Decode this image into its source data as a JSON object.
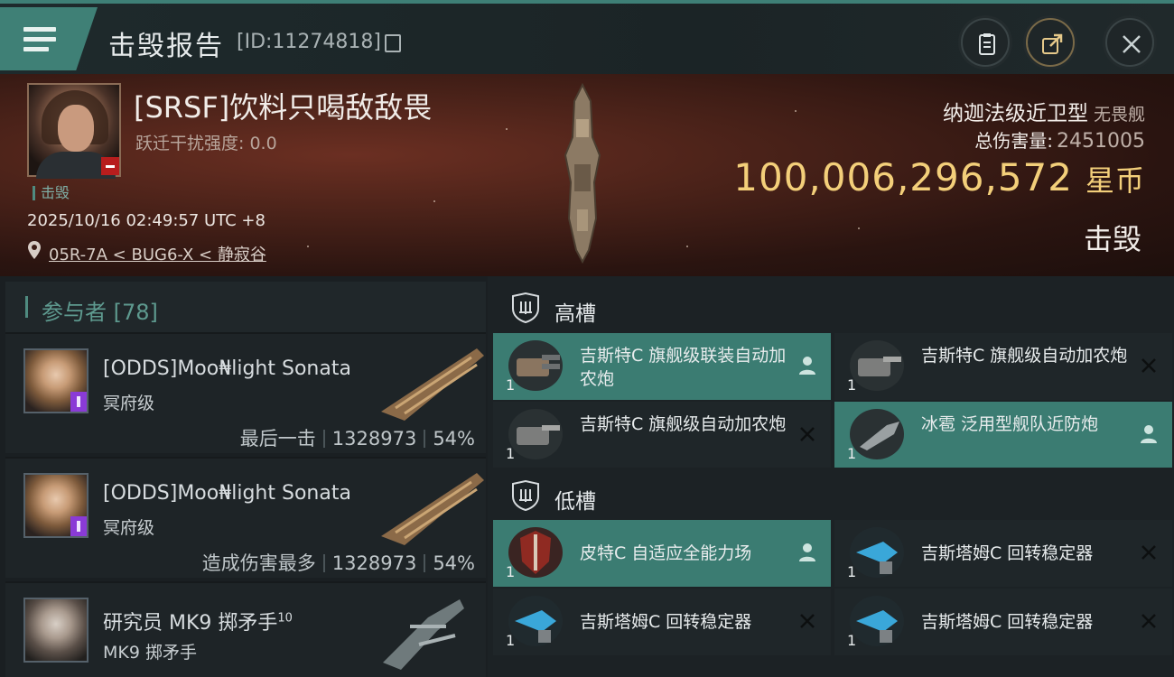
{
  "header": {
    "title": "击毁报告",
    "report_id": "[ID:11274818]"
  },
  "victim": {
    "name": "[SRSF]饮料只喝敌敌畏",
    "warp_disruption": "跃迁干扰强度: 0.0",
    "tag": "击毁",
    "time": "2025/10/16 02:49:57 UTC +8",
    "location": "05R-7A < BUG6-X < 静寂谷",
    "ship_class": "纳迦法级近卫型",
    "ship_class_sub": "无畏舰",
    "damage_label": "总伤害量:",
    "damage_value": "2451005",
    "isk_value": "100,006,296,572",
    "isk_unit": "星币",
    "status": "击毁"
  },
  "participants": {
    "label": "参与者 [78]",
    "rows": [
      {
        "name": "[ODDS]Moo₦light Sonata",
        "ship": "冥府级",
        "role": "最后一击",
        "damage": "1328973",
        "percent": "54%"
      },
      {
        "name": "[ODDS]Moo₦light Sonata",
        "ship": "冥府级",
        "role": "造成伤害最多",
        "damage": "1328973",
        "percent": "54%"
      },
      {
        "name": "研究员 MK9 掷矛手",
        "name_sup": "10",
        "ship": "MK9 掷矛手"
      }
    ]
  },
  "slots": {
    "high": {
      "label": "高槽",
      "modules": [
        {
          "name": "吉斯特C 旗舰级联装自动加农炮",
          "qty": "1",
          "state": "dropped"
        },
        {
          "name": "吉斯特C 旗舰级自动加农炮",
          "qty": "1",
          "state": "destroyed"
        },
        {
          "name": "吉斯特C 旗舰级自动加农炮",
          "qty": "1",
          "state": "destroyed"
        },
        {
          "name": "冰雹 泛用型舰队近防炮",
          "qty": "1",
          "state": "dropped"
        }
      ]
    },
    "low": {
      "label": "低槽",
      "modules": [
        {
          "name": "皮特C 自适应全能力场",
          "qty": "1",
          "state": "dropped"
        },
        {
          "name": "吉斯塔姆C 回转稳定器",
          "qty": "1",
          "state": "destroyed"
        },
        {
          "name": "吉斯塔姆C 回转稳定器",
          "qty": "1",
          "state": "destroyed"
        },
        {
          "name": "吉斯塔姆C 回转稳定器",
          "qty": "1",
          "state": "destroyed"
        }
      ]
    }
  },
  "colors": {
    "accent": "#3b7c72",
    "isk_gold": "#f3cf7a",
    "kill_red": "#b71d1d",
    "badge_purple": "#8a3bd6"
  },
  "icons": [
    "menu-icon",
    "clipboard-icon",
    "share-icon",
    "close-icon",
    "copy-icon",
    "location-pin-icon",
    "shield-icon",
    "pilot-icon",
    "x-icon"
  ]
}
